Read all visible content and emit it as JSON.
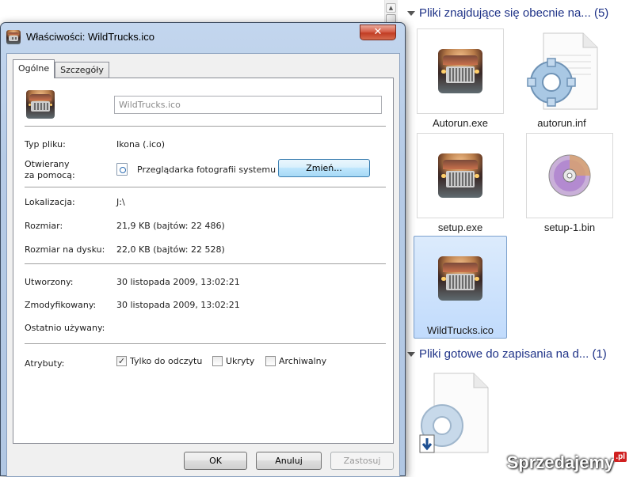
{
  "explorer": {
    "group1_header": "Pliki znajdujące się obecnie na... (5)",
    "group2_header": "Pliki gotowe do zapisania na d... (1)",
    "files": [
      {
        "name": "Autorun.exe",
        "icon": "truck-icon"
      },
      {
        "name": "autorun.inf",
        "icon": "settings-file-icon"
      },
      {
        "name": "setup.exe",
        "icon": "truck-icon"
      },
      {
        "name": "setup-1.bin",
        "icon": "disc-image-icon"
      },
      {
        "name": "WildTrucks.ico",
        "icon": "truck-icon",
        "selected": true
      }
    ],
    "pending_file_icon": "settings-file-pending-icon"
  },
  "dialog": {
    "title": "Właściwości: WildTrucks.ico",
    "close_label": "✕",
    "tabs": [
      "Ogólne",
      "Szczegóły"
    ],
    "active_tab": "Ogólne",
    "file_name": "WildTrucks.ico",
    "file_type_label": "Typ pliku:",
    "file_type_value": "Ikona (.ico)",
    "opens_with_label_1": "Otwierany",
    "opens_with_label_2": "za pomocą:",
    "opens_with_value": "Przeglądarka fotografii systemu W",
    "change_button": "Zmień...",
    "location_label": "Lokalizacja:",
    "location_value": "J:\\",
    "size_label": "Rozmiar:",
    "size_value": "21,9 KB (bajtów: 22 486)",
    "size_on_disk_label": "Rozmiar na dysku:",
    "size_on_disk_value": "22,0 KB (bajtów: 22 528)",
    "created_label": "Utworzony:",
    "created_value": "30 listopada 2009, 13:02:21",
    "modified_label": "Zmodyfikowany:",
    "modified_value": "30 listopada 2009, 13:02:21",
    "accessed_label": "Ostatnio używany:",
    "accessed_value": "",
    "attributes_label": "Atrybuty:",
    "attributes": [
      {
        "label": "Tylko do odczytu",
        "checked": true
      },
      {
        "label": "Ukryty",
        "checked": false
      },
      {
        "label": "Archiwalny",
        "checked": false
      }
    ],
    "ok_button": "OK",
    "cancel_button": "Anuluj",
    "apply_button": "Zastosuj"
  },
  "watermark": {
    "text": "Sprzedajemy",
    "suffix": ".pl"
  }
}
